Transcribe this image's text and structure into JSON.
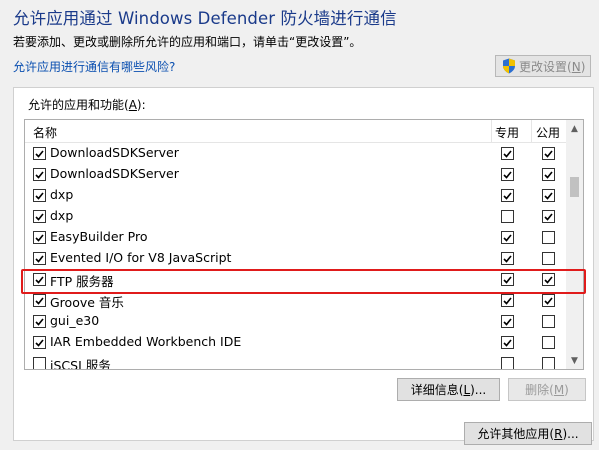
{
  "window": {
    "title": "允许应用通过 Windows Defender 防火墙进行通信",
    "subtitle": "若要添加、更改或删除所允许的应用和端口，请单击“更改设置”。",
    "risk_link": "允许应用进行通信有哪些风险?",
    "change_settings": {
      "label": "更改设置",
      "accel": "N",
      "close": ")"
    }
  },
  "group": {
    "label": "允许的应用和功能",
    "label_accel": "A",
    "label_suffix": "):"
  },
  "list": {
    "columns": {
      "name": "名称",
      "private": "专用",
      "public": "公用"
    },
    "rows": [
      {
        "name": "DownloadSDKServer",
        "enabled": true,
        "private": true,
        "public": true
      },
      {
        "name": "DownloadSDKServer",
        "enabled": true,
        "private": true,
        "public": true
      },
      {
        "name": "dxp",
        "enabled": true,
        "private": true,
        "public": true
      },
      {
        "name": "dxp",
        "enabled": true,
        "private": false,
        "public": true
      },
      {
        "name": "EasyBuilder Pro",
        "enabled": true,
        "private": true,
        "public": false
      },
      {
        "name": "Evented I/O for V8 JavaScript",
        "enabled": true,
        "private": true,
        "public": false
      },
      {
        "name": "FTP 服务器",
        "enabled": true,
        "private": true,
        "public": true
      },
      {
        "name": "Groove 音乐",
        "enabled": true,
        "private": true,
        "public": true
      },
      {
        "name": "gui_e30",
        "enabled": true,
        "private": true,
        "public": false
      },
      {
        "name": "IAR Embedded Workbench IDE",
        "enabled": true,
        "private": true,
        "public": false
      },
      {
        "name": "iSCSI 服务",
        "enabled": false,
        "private": false,
        "public": false
      }
    ],
    "highlighted_row": "FTP 服务器"
  },
  "buttons": {
    "details": {
      "label": "详细信息(",
      "accel": "L",
      "suffix": ")..."
    },
    "remove": {
      "label": "删除(",
      "accel": "M",
      "suffix": ")"
    },
    "allow_other": {
      "label": "允许其他应用(",
      "accel": "R",
      "suffix": ")..."
    }
  },
  "colors": {
    "title": "#1a3a8a",
    "link": "#0a4fb0",
    "highlight": "#e01b1b"
  }
}
